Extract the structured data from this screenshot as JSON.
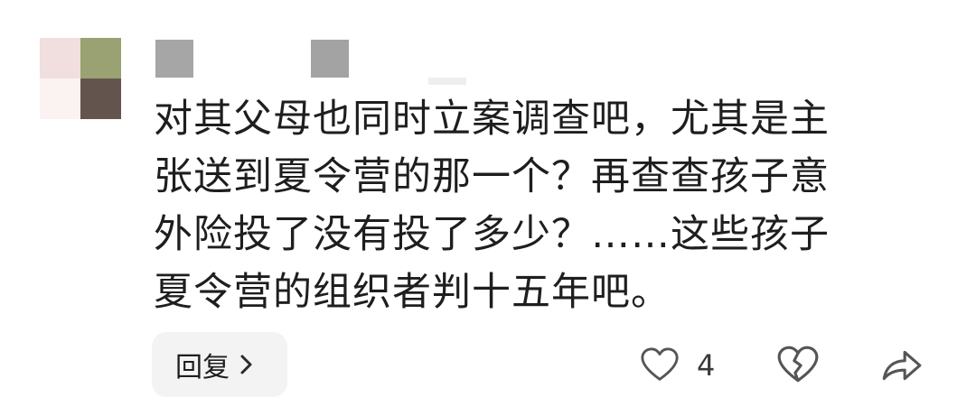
{
  "comment": {
    "author": "",
    "text": "对其父母也同时立案调查吧，尤其是主\n张送到夏令营的那一个？再查查孩子意\n外险投了没有投了多少？……这些孩子\n夏令营的组织者判十五年吧。",
    "reply_label": "回复",
    "like_count": "4",
    "icons": {
      "reply": "chevron-right-icon",
      "like": "heart-outline-icon",
      "dislike": "broken-heart-icon",
      "share": "share-arrow-icon"
    },
    "colors": {
      "text": "#1e1e1e",
      "icon": "#555555",
      "reply_bg": "#f3f3f3"
    }
  }
}
